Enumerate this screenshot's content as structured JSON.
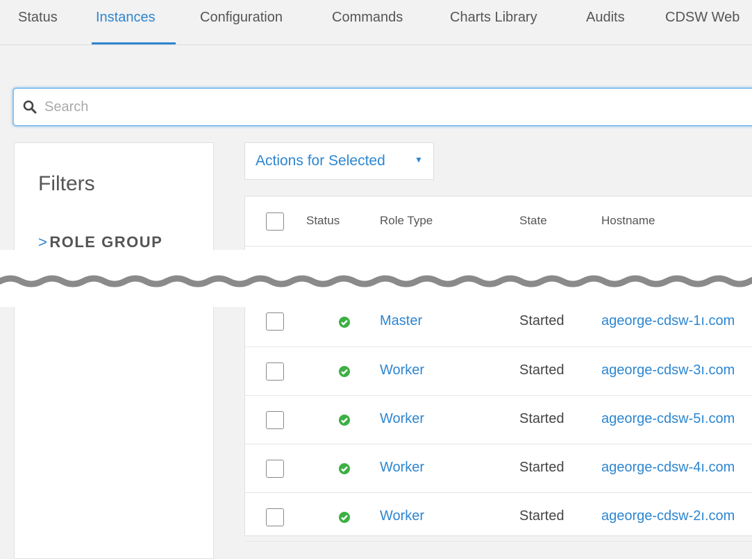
{
  "tabs": [
    {
      "label": "Status"
    },
    {
      "label": "Instances"
    },
    {
      "label": "Configuration"
    },
    {
      "label": "Commands"
    },
    {
      "label": "Charts Library"
    },
    {
      "label": "Audits"
    },
    {
      "label": "CDSW Web"
    }
  ],
  "search": {
    "placeholder": "Search"
  },
  "filters": {
    "title": "Filters",
    "role_group": "ROLE GROUP"
  },
  "actions": {
    "label": "Actions for Selected"
  },
  "table": {
    "headers": {
      "status": "Status",
      "role_type": "Role Type",
      "state": "State",
      "hostname": "Hostname"
    },
    "rows": [
      {
        "role": "Master",
        "state": "Started",
        "host": "ageorge-cdsw-1ı.com"
      },
      {
        "role": "Worker",
        "state": "Started",
        "host": "ageorge-cdsw-3ı.com"
      },
      {
        "role": "Worker",
        "state": "Started",
        "host": "ageorge-cdsw-5ı.com"
      },
      {
        "role": "Worker",
        "state": "Started",
        "host": "ageorge-cdsw-4ı.com"
      },
      {
        "role": "Worker",
        "state": "Started",
        "host": "ageorge-cdsw-2ı.com"
      }
    ]
  },
  "colors": {
    "accent": "#2d86d0",
    "ok": "#3cb043"
  }
}
